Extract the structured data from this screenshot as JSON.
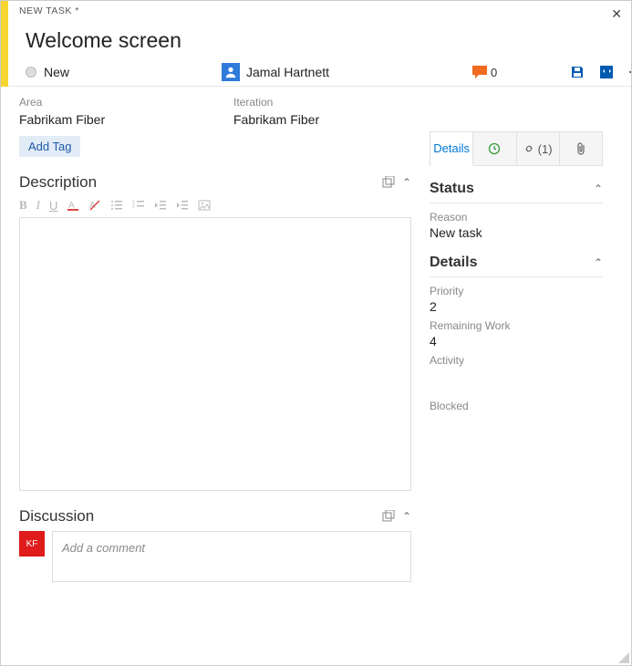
{
  "header": {
    "breadcrumb": "NEW TASK *",
    "title": "Welcome screen",
    "state": "New",
    "assignee": "Jamal Hartnett",
    "comment_count": "0"
  },
  "classification": {
    "area_label": "Area",
    "area_value": "Fabrikam Fiber",
    "iteration_label": "Iteration",
    "iteration_value": "Fabrikam Fiber"
  },
  "tags": {
    "add_tag": "Add Tag"
  },
  "sections": {
    "description": "Description",
    "discussion": "Discussion"
  },
  "discussion": {
    "avatar_initials": "KF",
    "placeholder": "Add a comment"
  },
  "tabs": {
    "details": "Details",
    "links_count": "(1)"
  },
  "status_panel": {
    "title": "Status",
    "reason_label": "Reason",
    "reason_value": "New task"
  },
  "details_panel": {
    "title": "Details",
    "priority_label": "Priority",
    "priority_value": "2",
    "remaining_label": "Remaining Work",
    "remaining_value": "4",
    "activity_label": "Activity",
    "blocked_label": "Blocked"
  },
  "colors": {
    "accent": "#0078d4",
    "yellow": "#f7d631",
    "comment_orange": "#f06a1f",
    "save_blue": "#005bb1"
  }
}
